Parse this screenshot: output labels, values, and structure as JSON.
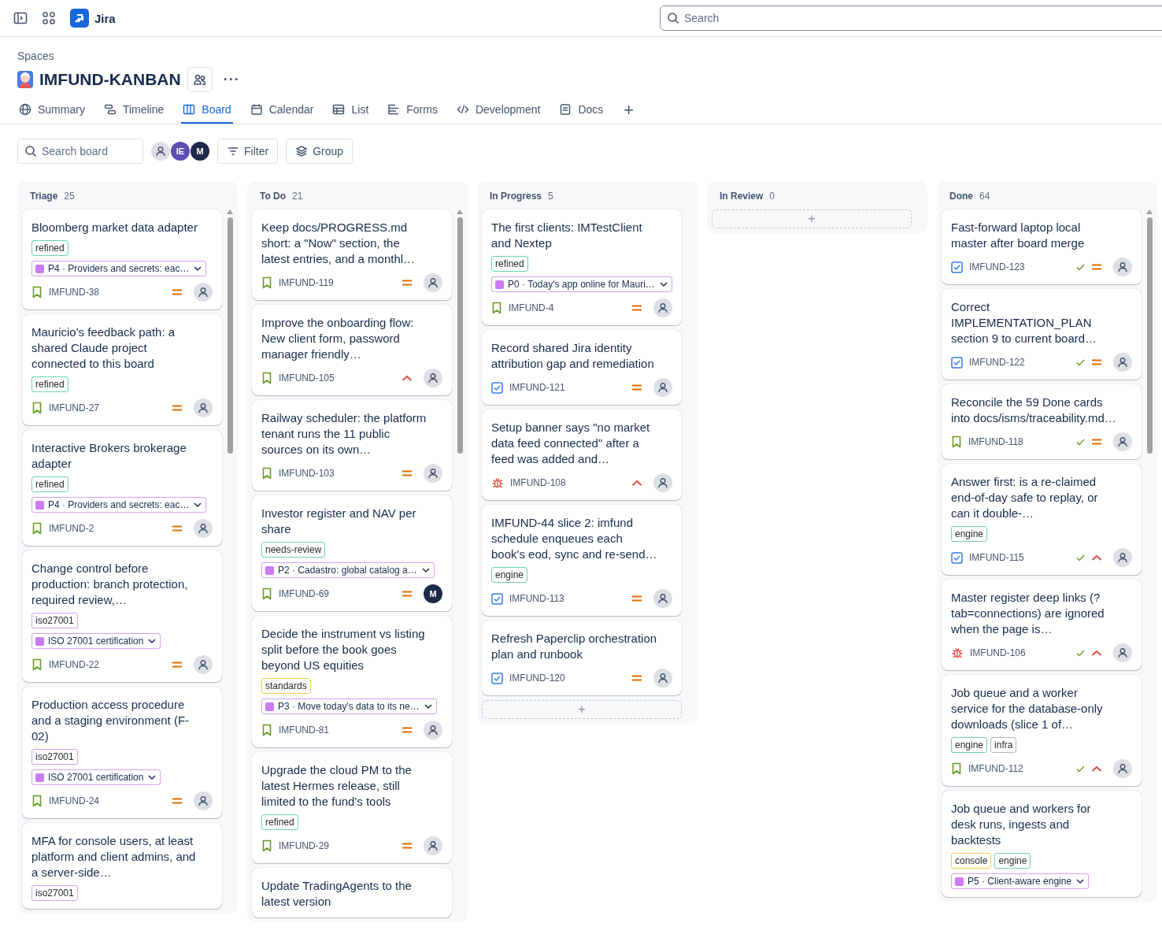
{
  "topbar": {
    "product": "Jira",
    "search": {
      "placeholder": "Search"
    }
  },
  "project": {
    "breadcrumb": "Spaces",
    "title": "IMFUND-KANBAN",
    "more": "···"
  },
  "tabs": [
    {
      "label": "Summary",
      "kind": "globe",
      "selected": false
    },
    {
      "label": "Timeline",
      "kind": "timeline",
      "selected": false
    },
    {
      "label": "Board",
      "kind": "board",
      "selected": true
    },
    {
      "label": "Calendar",
      "kind": "calendar",
      "selected": false
    },
    {
      "label": "List",
      "kind": "list",
      "selected": false
    },
    {
      "label": "Forms",
      "kind": "forms",
      "selected": false
    },
    {
      "label": "Development",
      "kind": "code",
      "selected": false
    },
    {
      "label": "Docs",
      "kind": "docs",
      "selected": false
    }
  ],
  "add_tab": "+",
  "toolbar": {
    "search": {
      "placeholder": "Search board"
    },
    "avatars": [
      {
        "kind": "person"
      },
      {
        "kind": "initials",
        "text": "IE",
        "color": "#5e4db2"
      },
      {
        "kind": "initials",
        "text": "M",
        "color": "#1c2b4a"
      }
    ],
    "buttons": [
      {
        "label": "Filter",
        "kind": "filter"
      },
      {
        "label": "Group",
        "kind": "layers"
      }
    ]
  },
  "columns": [
    {
      "name": "Triage",
      "count": "25",
      "scrollbar": true,
      "cards": [
        {
          "title": "Bloomberg market data adapter",
          "labels": [
            {
              "text": "refined",
              "color": "#6cd3b3"
            }
          ],
          "epic": "P4 · Providers and secrets: eac…",
          "footer": {
            "key": "IMFUND-38",
            "kind": "story",
            "done": false,
            "high_priority": false,
            "assignee": {
              "kind": "person"
            }
          }
        },
        {
          "title": "Mauricio's feedback path: a shared Claude project connected to this board",
          "labels": [
            {
              "text": "refined",
              "color": "#6cd3b3"
            }
          ],
          "footer": {
            "key": "IMFUND-27",
            "kind": "story",
            "done": false,
            "high_priority": false,
            "assignee": {
              "kind": "person"
            }
          }
        },
        {
          "title": "Interactive Brokers brokerage adapter",
          "labels": [
            {
              "text": "refined",
              "color": "#6cd3b3"
            }
          ],
          "epic": "P4 · Providers and secrets: eac…",
          "footer": {
            "key": "IMFUND-2",
            "kind": "story",
            "done": false,
            "high_priority": false,
            "assignee": {
              "kind": "person"
            }
          }
        },
        {
          "title": "Change control before production: branch protection, required review,…",
          "labels": [
            {
              "text": "iso27001",
              "color": "#d8a0f0"
            }
          ],
          "epic": "ISO 27001 certification",
          "footer": {
            "key": "IMFUND-22",
            "kind": "story",
            "done": false,
            "high_priority": false,
            "assignee": {
              "kind": "person"
            }
          }
        },
        {
          "title": "Production access procedure and a staging environment (F-02)",
          "labels": [
            {
              "text": "iso27001",
              "color": "#d8a0f0"
            }
          ],
          "epic": "ISO 27001 certification",
          "footer": {
            "key": "IMFUND-24",
            "kind": "story",
            "done": false,
            "high_priority": false,
            "assignee": {
              "kind": "person"
            }
          }
        },
        {
          "title": "MFA for console users, at least platform and client admins, and a server-side…",
          "labels": [
            {
              "text": "iso27001",
              "color": "#d8a0f0"
            }
          ]
        }
      ]
    },
    {
      "name": "To Do",
      "count": "21",
      "scrollbar": true,
      "cards": [
        {
          "title": "Keep docs/PROGRESS.md short: a \"Now\" section, the latest entries, and a monthl…",
          "footer": {
            "key": "IMFUND-119",
            "kind": "story",
            "done": false,
            "high_priority": false,
            "assignee": {
              "kind": "person"
            }
          }
        },
        {
          "title": "Improve the onboarding flow: New client form, password manager friendly…",
          "footer": {
            "key": "IMFUND-105",
            "kind": "story",
            "done": false,
            "high_priority": true,
            "assignee": {
              "kind": "person"
            }
          }
        },
        {
          "title": "Railway scheduler: the platform tenant runs the 11 public sources on its own…",
          "footer": {
            "key": "IMFUND-103",
            "kind": "story",
            "done": false,
            "high_priority": false,
            "assignee": {
              "kind": "person"
            }
          }
        },
        {
          "title": "Investor register and NAV per share",
          "labels": [
            {
              "text": "needs-review",
              "color": "#6cd3b3"
            }
          ],
          "epic": "P2 · Cadastro: global catalog a…",
          "footer": {
            "key": "IMFUND-69",
            "kind": "story",
            "done": false,
            "high_priority": false,
            "assignee": {
              "kind": "initials",
              "text": "M"
            }
          }
        },
        {
          "title": "Decide the instrument vs listing split before the book goes beyond US equities",
          "labels": [
            {
              "text": "standards",
              "color": "#f5cd47"
            }
          ],
          "epic": "P3 · Move today's data to its ne…",
          "footer": {
            "key": "IMFUND-81",
            "kind": "story",
            "done": false,
            "high_priority": false,
            "assignee": {
              "kind": "person"
            }
          }
        },
        {
          "title": "Upgrade the cloud PM to the latest Hermes release, still limited to the fund's tools",
          "labels": [
            {
              "text": "refined",
              "color": "#6cd3b3"
            }
          ],
          "footer": {
            "key": "IMFUND-29",
            "kind": "story",
            "done": false,
            "high_priority": false,
            "assignee": {
              "kind": "person"
            }
          }
        },
        {
          "title": "Update TradingAgents to the latest version"
        }
      ]
    },
    {
      "name": "In Progress",
      "count": "5",
      "scrollbar": false,
      "add": "+",
      "cards": [
        {
          "title": "The first clients: IMTestClient and Nextep",
          "labels": [
            {
              "text": "refined",
              "color": "#6cd3b3"
            }
          ],
          "epic": "P0 · Today's app online for Mauri…",
          "footer": {
            "key": "IMFUND-4",
            "kind": "story",
            "done": false,
            "high_priority": false,
            "assignee": {
              "kind": "person"
            }
          }
        },
        {
          "title": "Record shared Jira identity attribution gap and remediation",
          "footer": {
            "key": "IMFUND-121",
            "kind": "task",
            "done": false,
            "high_priority": false,
            "assignee": {
              "kind": "person"
            }
          }
        },
        {
          "title": "Setup banner says \"no market data feed connected\" after a feed was added and…",
          "footer": {
            "key": "IMFUND-108",
            "kind": "bug",
            "done": false,
            "high_priority": true,
            "assignee": {
              "kind": "person"
            }
          }
        },
        {
          "title": "IMFUND-44 slice 2: imfund schedule enqueues each book's eod, sync and re-send…",
          "labels": [
            {
              "text": "engine",
              "color": "#6cd3b3"
            }
          ],
          "footer": {
            "key": "IMFUND-113",
            "kind": "task",
            "done": false,
            "high_priority": false,
            "assignee": {
              "kind": "person"
            }
          }
        },
        {
          "title": "Refresh Paperclip orchestration plan and runbook",
          "footer": {
            "key": "IMFUND-120",
            "kind": "task",
            "done": false,
            "high_priority": false,
            "assignee": {
              "kind": "person"
            }
          }
        }
      ]
    },
    {
      "name": "In Review",
      "count": "0",
      "scrollbar": false,
      "add": "+"
    },
    {
      "name": "Done",
      "count": "64",
      "scrollbar": true,
      "cards": [
        {
          "title": "Fast-forward laptop local master after board merge",
          "footer": {
            "key": "IMFUND-123",
            "kind": "task",
            "done": true,
            "high_priority": false,
            "assignee": {
              "kind": "person"
            }
          }
        },
        {
          "title": "Correct IMPLEMENTATION_PLAN section 9 to current board…",
          "footer": {
            "key": "IMFUND-122",
            "kind": "task",
            "done": true,
            "high_priority": false,
            "assignee": {
              "kind": "person"
            }
          }
        },
        {
          "title": "Reconcile the 59 Done cards into docs/isms/traceability.md…",
          "footer": {
            "key": "IMFUND-118",
            "kind": "story",
            "done": true,
            "high_priority": false,
            "assignee": {
              "kind": "person"
            }
          }
        },
        {
          "title": "Answer first: is a re-claimed end-of-day safe to replay, or can it double-…",
          "labels": [
            {
              "text": "engine",
              "color": "#6cd3b3"
            }
          ],
          "footer": {
            "key": "IMFUND-115",
            "kind": "task",
            "done": true,
            "high_priority": true,
            "assignee": {
              "kind": "person"
            }
          }
        },
        {
          "title": "Master register deep links (?tab=connections) are ignored when the page is…",
          "footer": {
            "key": "IMFUND-106",
            "kind": "bug",
            "done": true,
            "high_priority": true,
            "assignee": {
              "kind": "person"
            }
          }
        },
        {
          "title": "Job queue and a worker service for the database-only downloads (slice 1 of…",
          "labels": [
            {
              "text": "engine",
              "color": "#6cd3b3"
            },
            {
              "text": "infra",
              "color": "#b3b9c4"
            }
          ],
          "footer": {
            "key": "IMFUND-112",
            "kind": "story",
            "done": true,
            "high_priority": true,
            "assignee": {
              "kind": "person"
            }
          }
        },
        {
          "title": "Job queue and workers for desk runs, ingests and backtests",
          "labels": [
            {
              "text": "console",
              "color": "#f5cd47"
            },
            {
              "text": "engine",
              "color": "#6cd3b3"
            }
          ],
          "epic": "P5 · Client-aware engine"
        }
      ]
    }
  ]
}
